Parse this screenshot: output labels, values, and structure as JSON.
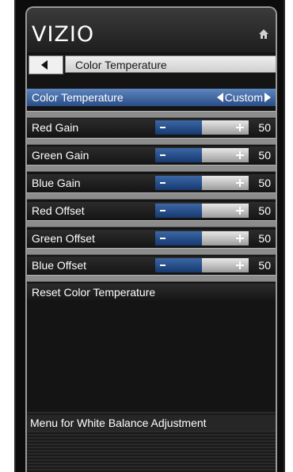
{
  "brand": {
    "logo": "VIZIO",
    "home_icon": "home-icon"
  },
  "nav": {
    "back_icon": "back-arrow-icon",
    "title": "Color Temperature"
  },
  "color_temperature": {
    "label": "Color Temperature",
    "value": "Custom"
  },
  "sliders": [
    {
      "label": "Red Gain",
      "value": "50",
      "level": 0.5
    },
    {
      "label": "Green Gain",
      "value": "50",
      "level": 0.5
    },
    {
      "label": "Blue Gain",
      "value": "50",
      "level": 0.5
    },
    {
      "label": "Red Offset",
      "value": "50",
      "level": 0.5
    },
    {
      "label": "Green Offset",
      "value": "50",
      "level": 0.5
    },
    {
      "label": "Blue Offset",
      "value": "50",
      "level": 0.5
    }
  ],
  "reset": {
    "label": "Reset Color Temperature"
  },
  "footer": {
    "hint": "Menu for White Balance Adjustment"
  },
  "colors": {
    "selected": "#294d86",
    "slider_fill": "#16396f"
  }
}
